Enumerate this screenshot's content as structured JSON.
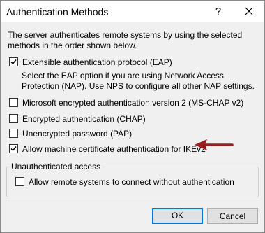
{
  "window": {
    "title": "Authentication Methods",
    "help_glyph": "?"
  },
  "intro_text": "The server authenticates remote systems by using the selected methods in the order shown below.",
  "options": [
    {
      "label": "Extensible authentication protocol (EAP)",
      "checked": true
    },
    {
      "label": "Microsoft encrypted authentication version 2 (MS-CHAP v2)",
      "checked": false
    },
    {
      "label": "Encrypted authentication (CHAP)",
      "checked": false
    },
    {
      "label": "Unencrypted password (PAP)",
      "checked": false
    },
    {
      "label": "Allow machine certificate authentication for IKEv2",
      "checked": true
    }
  ],
  "eap_note": "Select the EAP option if you are using Network Access Protection (NAP). Use NPS to configure all other NAP settings.",
  "unauthenticated": {
    "group_title": "Unauthenticated access",
    "option": {
      "label": "Allow remote systems to connect without authentication",
      "checked": false
    }
  },
  "buttons": {
    "ok": "OK",
    "cancel": "Cancel"
  },
  "colors": {
    "annotation_arrow": "#9b1c1f",
    "default_button_border": "#0078d7"
  },
  "icons": {
    "help": "help-icon",
    "close": "close-icon",
    "check": "checkmark-icon",
    "arrow": "arrow-left-icon"
  }
}
